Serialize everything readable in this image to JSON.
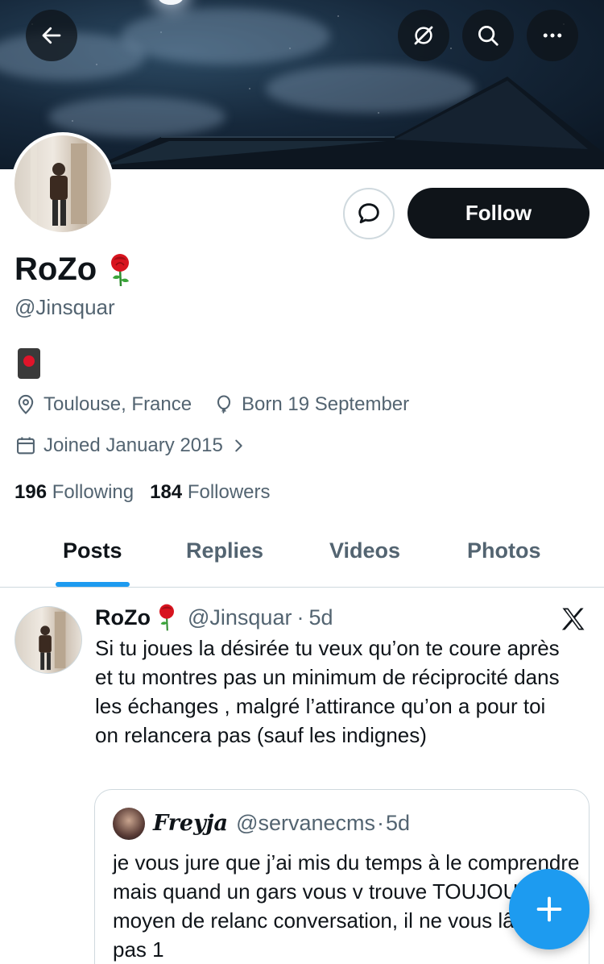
{
  "profile": {
    "name": "RoZo",
    "handle": "@Jinsquar",
    "location": "Toulouse, France",
    "birthday": "Born 19 September",
    "joined": "Joined January 2015",
    "following_count": "196",
    "following_label": "Following",
    "followers_count": "184",
    "followers_label": "Followers"
  },
  "actions": {
    "follow_label": "Follow"
  },
  "tabs": [
    {
      "label": "Posts",
      "active": true
    },
    {
      "label": "Replies",
      "active": false
    },
    {
      "label": "Videos",
      "active": false
    },
    {
      "label": "Photos",
      "active": false
    }
  ],
  "post": {
    "author": "RoZo",
    "handle": "@Jinsquar",
    "separator": "·",
    "time": "5d",
    "text": "Si tu joues la désirée tu veux qu’on te coure après et tu montres pas un minimum de réciprocité dans les échanges , malgré l’attirance qu’on a pour toi on relancera pas (sauf les indignes)"
  },
  "quote": {
    "author": "Freyja",
    "handle": "@servanecms",
    "separator": "·",
    "time": "5d",
    "text": "je vous jure que j’ai mis du temps à le comprendre mais quand un gars vous v trouve TOUJOURS un moyen de relanc conversation, il ne vous lâche pas 1"
  },
  "icons": {
    "back": "arrow-left-icon",
    "grok": "grok-icon",
    "search": "search-icon",
    "more": "more-icon",
    "message": "message-icon",
    "location": "location-pin-icon",
    "birthday": "balloon-icon",
    "calendar": "calendar-icon",
    "compose": "plus-icon"
  },
  "colors": {
    "accent": "#1d9bf0",
    "text": "#0f1419",
    "secondary": "#536471",
    "border": "#cfd9de"
  }
}
